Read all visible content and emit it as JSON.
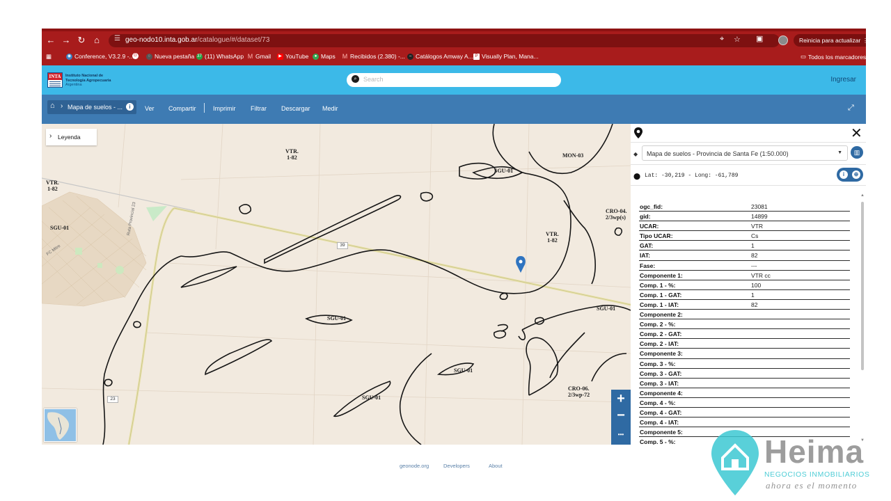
{
  "browser": {
    "url_host": "geo-nodo10.inta.gob.ar",
    "url_path": "/catalogue/#/dataset/73",
    "update_button": "Reinicia para actualizar",
    "accent_color": "#a81c1c",
    "bookmarks": [
      {
        "label": "Conference, V3.2.9 -...",
        "icon": "chrome-icon",
        "color": "#3b82c4"
      },
      {
        "label": "",
        "icon": "google-icon",
        "color": "#ffffff"
      },
      {
        "label": "Nueva pestaña",
        "icon": "globe-icon",
        "color": "#555555"
      },
      {
        "label": "(11) WhatsApp",
        "icon": "whatsapp-icon",
        "color": "#25a244",
        "badge": "37"
      },
      {
        "label": "Gmail",
        "icon": "gmail-icon",
        "color": "#e0473b"
      },
      {
        "label": "YouTube",
        "icon": "youtube-icon",
        "color": "#ff0000"
      },
      {
        "label": "Maps",
        "icon": "maps-icon",
        "color": "#34a853"
      },
      {
        "label": "Recibidos (2.380) -...",
        "icon": "gmail-icon",
        "color": "#e0473b"
      },
      {
        "label": "Catálogos Amway A...",
        "icon": "amway-icon",
        "color": "#222222"
      },
      {
        "label": "Visually Plan, Mana...",
        "icon": "doc-icon",
        "color": "#ffffff"
      }
    ],
    "all_bookmarks": "Todos los marcadores"
  },
  "header": {
    "org_line1": "Instituto Nacional de",
    "org_line2": "Tecnología Agropecuaria",
    "org_line3": "Argentina",
    "logo_text": "INTA",
    "search_placeholder": "Search",
    "login": "Ingresar"
  },
  "map_toolbar": {
    "breadcrumb": "Mapa de suelos - ...",
    "menu": [
      "Ver",
      "Compartir",
      "Imprimir",
      "Filtrar",
      "Descargar",
      "Medir"
    ]
  },
  "map": {
    "legend": "Leyenda",
    "unit_labels": [
      {
        "text": "VTR.\n1-82"
      },
      {
        "text": "VTR.\n1-82"
      },
      {
        "text": "VTR.\n1-82"
      },
      {
        "text": "MON-03"
      },
      {
        "text": "SGU-01"
      },
      {
        "text": "SGU-01"
      },
      {
        "text": "SGU-01"
      },
      {
        "text": "SGU-01"
      },
      {
        "text": "SGU-01"
      },
      {
        "text": "SGU-01"
      },
      {
        "text": "CRO-04.\n2/3wp(s)"
      },
      {
        "text": "CRO-06.\n2/3wp-72"
      }
    ],
    "road_labels": [
      "Ruta Provincial 23",
      "FC Mitre"
    ],
    "route_shields": [
      "39",
      "23"
    ],
    "zoom_in": "+",
    "zoom_out": "−",
    "more": "•••"
  },
  "panel": {
    "layer": "Mapa de suelos - Provincia de Santa Fe (1:50.000)",
    "coordinates": "Lat: -30,219 - Long: -61,789",
    "attributes": [
      {
        "key": "ogc_fid:",
        "value": "23081"
      },
      {
        "key": "gid:",
        "value": "14899"
      },
      {
        "key": "UCAR:",
        "value": "VTR"
      },
      {
        "key": "Tipo UCAR:",
        "value": "Cs"
      },
      {
        "key": "GAT:",
        "value": "1"
      },
      {
        "key": "IAT:",
        "value": "82"
      },
      {
        "key": "Fase:",
        "value": "---"
      },
      {
        "key": "Componente 1:",
        "value": "VTR cc"
      },
      {
        "key": "Comp. 1 - %:",
        "value": "100"
      },
      {
        "key": "Comp. 1 - GAT:",
        "value": "1"
      },
      {
        "key": "Comp. 1 - IAT:",
        "value": "82"
      },
      {
        "key": "Componente 2:",
        "value": ""
      },
      {
        "key": "Comp. 2 - %:",
        "value": ""
      },
      {
        "key": "Comp. 2 - GAT:",
        "value": ""
      },
      {
        "key": "Comp. 2 - IAT:",
        "value": ""
      },
      {
        "key": "Componente 3:",
        "value": ""
      },
      {
        "key": "Comp. 3 - %:",
        "value": ""
      },
      {
        "key": "Comp. 3 - GAT:",
        "value": ""
      },
      {
        "key": "Comp. 3 - IAT:",
        "value": ""
      },
      {
        "key": "Componente 4:",
        "value": ""
      },
      {
        "key": "Comp. 4 - %:",
        "value": ""
      },
      {
        "key": "Comp. 4 - GAT:",
        "value": ""
      },
      {
        "key": "Comp. 4 - IAT:",
        "value": ""
      },
      {
        "key": "Componente 5:",
        "value": ""
      },
      {
        "key": "Comp. 5 - %:",
        "value": ""
      }
    ]
  },
  "footer": [
    "geonode.org",
    "Developers",
    "About"
  ],
  "watermark": {
    "brand": "Heima",
    "tagline": "NEGOCIOS INMOBILIARIOS",
    "slogan": "ahora es el momento",
    "color": "#3cc8d2"
  }
}
